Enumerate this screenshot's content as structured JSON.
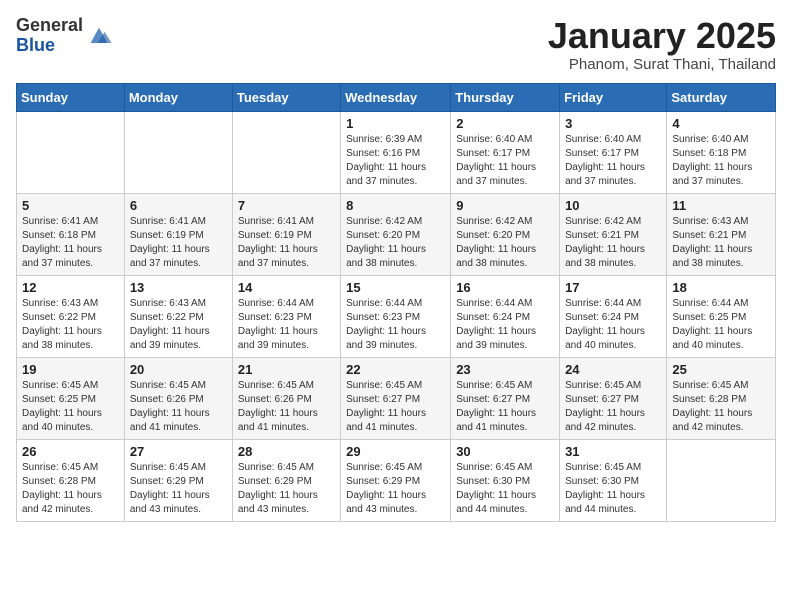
{
  "header": {
    "logo_general": "General",
    "logo_blue": "Blue",
    "month_title": "January 2025",
    "subtitle": "Phanom, Surat Thani, Thailand"
  },
  "weekdays": [
    "Sunday",
    "Monday",
    "Tuesday",
    "Wednesday",
    "Thursday",
    "Friday",
    "Saturday"
  ],
  "weeks": [
    [
      {
        "day": null
      },
      {
        "day": null
      },
      {
        "day": null
      },
      {
        "day": "1",
        "sunrise": "6:39 AM",
        "sunset": "6:16 PM",
        "daylight": "11 hours and 37 minutes."
      },
      {
        "day": "2",
        "sunrise": "6:40 AM",
        "sunset": "6:17 PM",
        "daylight": "11 hours and 37 minutes."
      },
      {
        "day": "3",
        "sunrise": "6:40 AM",
        "sunset": "6:17 PM",
        "daylight": "11 hours and 37 minutes."
      },
      {
        "day": "4",
        "sunrise": "6:40 AM",
        "sunset": "6:18 PM",
        "daylight": "11 hours and 37 minutes."
      }
    ],
    [
      {
        "day": "5",
        "sunrise": "6:41 AM",
        "sunset": "6:18 PM",
        "daylight": "11 hours and 37 minutes."
      },
      {
        "day": "6",
        "sunrise": "6:41 AM",
        "sunset": "6:19 PM",
        "daylight": "11 hours and 37 minutes."
      },
      {
        "day": "7",
        "sunrise": "6:41 AM",
        "sunset": "6:19 PM",
        "daylight": "11 hours and 37 minutes."
      },
      {
        "day": "8",
        "sunrise": "6:42 AM",
        "sunset": "6:20 PM",
        "daylight": "11 hours and 38 minutes."
      },
      {
        "day": "9",
        "sunrise": "6:42 AM",
        "sunset": "6:20 PM",
        "daylight": "11 hours and 38 minutes."
      },
      {
        "day": "10",
        "sunrise": "6:42 AM",
        "sunset": "6:21 PM",
        "daylight": "11 hours and 38 minutes."
      },
      {
        "day": "11",
        "sunrise": "6:43 AM",
        "sunset": "6:21 PM",
        "daylight": "11 hours and 38 minutes."
      }
    ],
    [
      {
        "day": "12",
        "sunrise": "6:43 AM",
        "sunset": "6:22 PM",
        "daylight": "11 hours and 38 minutes."
      },
      {
        "day": "13",
        "sunrise": "6:43 AM",
        "sunset": "6:22 PM",
        "daylight": "11 hours and 39 minutes."
      },
      {
        "day": "14",
        "sunrise": "6:44 AM",
        "sunset": "6:23 PM",
        "daylight": "11 hours and 39 minutes."
      },
      {
        "day": "15",
        "sunrise": "6:44 AM",
        "sunset": "6:23 PM",
        "daylight": "11 hours and 39 minutes."
      },
      {
        "day": "16",
        "sunrise": "6:44 AM",
        "sunset": "6:24 PM",
        "daylight": "11 hours and 39 minutes."
      },
      {
        "day": "17",
        "sunrise": "6:44 AM",
        "sunset": "6:24 PM",
        "daylight": "11 hours and 40 minutes."
      },
      {
        "day": "18",
        "sunrise": "6:44 AM",
        "sunset": "6:25 PM",
        "daylight": "11 hours and 40 minutes."
      }
    ],
    [
      {
        "day": "19",
        "sunrise": "6:45 AM",
        "sunset": "6:25 PM",
        "daylight": "11 hours and 40 minutes."
      },
      {
        "day": "20",
        "sunrise": "6:45 AM",
        "sunset": "6:26 PM",
        "daylight": "11 hours and 41 minutes."
      },
      {
        "day": "21",
        "sunrise": "6:45 AM",
        "sunset": "6:26 PM",
        "daylight": "11 hours and 41 minutes."
      },
      {
        "day": "22",
        "sunrise": "6:45 AM",
        "sunset": "6:27 PM",
        "daylight": "11 hours and 41 minutes."
      },
      {
        "day": "23",
        "sunrise": "6:45 AM",
        "sunset": "6:27 PM",
        "daylight": "11 hours and 41 minutes."
      },
      {
        "day": "24",
        "sunrise": "6:45 AM",
        "sunset": "6:27 PM",
        "daylight": "11 hours and 42 minutes."
      },
      {
        "day": "25",
        "sunrise": "6:45 AM",
        "sunset": "6:28 PM",
        "daylight": "11 hours and 42 minutes."
      }
    ],
    [
      {
        "day": "26",
        "sunrise": "6:45 AM",
        "sunset": "6:28 PM",
        "daylight": "11 hours and 42 minutes."
      },
      {
        "day": "27",
        "sunrise": "6:45 AM",
        "sunset": "6:29 PM",
        "daylight": "11 hours and 43 minutes."
      },
      {
        "day": "28",
        "sunrise": "6:45 AM",
        "sunset": "6:29 PM",
        "daylight": "11 hours and 43 minutes."
      },
      {
        "day": "29",
        "sunrise": "6:45 AM",
        "sunset": "6:29 PM",
        "daylight": "11 hours and 43 minutes."
      },
      {
        "day": "30",
        "sunrise": "6:45 AM",
        "sunset": "6:30 PM",
        "daylight": "11 hours and 44 minutes."
      },
      {
        "day": "31",
        "sunrise": "6:45 AM",
        "sunset": "6:30 PM",
        "daylight": "11 hours and 44 minutes."
      },
      {
        "day": null
      }
    ]
  ],
  "labels": {
    "sunrise": "Sunrise:",
    "sunset": "Sunset:",
    "daylight": "Daylight:"
  }
}
